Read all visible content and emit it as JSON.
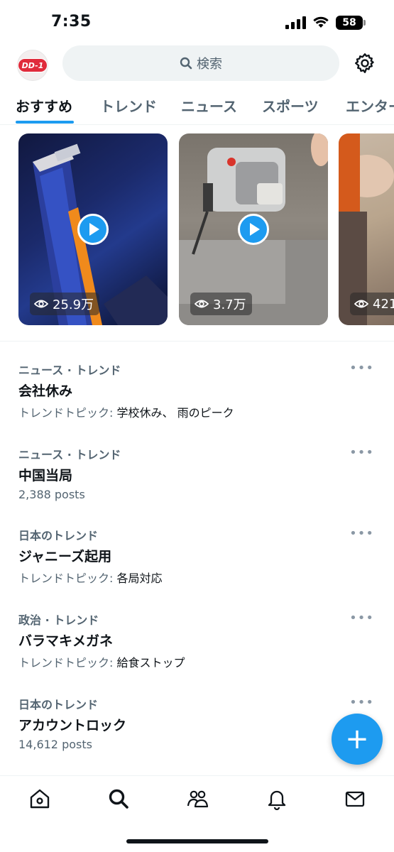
{
  "status_bar": {
    "time": "7:35",
    "battery": "58"
  },
  "header": {
    "avatar_text": "DD-1",
    "search_placeholder": "検索"
  },
  "tabs": [
    {
      "label": "おすすめ",
      "active": true
    },
    {
      "label": "トレンド",
      "active": false
    },
    {
      "label": "ニュース",
      "active": false
    },
    {
      "label": "スポーツ",
      "active": false
    },
    {
      "label": "エンター",
      "active": false
    }
  ],
  "videos": [
    {
      "views": "25.9万"
    },
    {
      "views": "3.7万"
    },
    {
      "views": "421"
    }
  ],
  "trends": [
    {
      "category": "ニュース · トレンド",
      "title": "会社休み",
      "meta_prefix": "トレンドトピック: ",
      "meta_topics": "学校休み、 雨のピーク"
    },
    {
      "category": "ニュース · トレンド",
      "title": "中国当局",
      "meta_prefix": "2,388 posts",
      "meta_topics": ""
    },
    {
      "category": "日本のトレンド",
      "title": "ジャニーズ起用",
      "meta_prefix": "トレンドトピック: ",
      "meta_topics": "各局対応"
    },
    {
      "category": "政治 · トレンド",
      "title": "バラマキメガネ",
      "meta_prefix": "トレンドトピック: ",
      "meta_topics": "給食ストップ"
    },
    {
      "category": "日本のトレンド",
      "title": "アカウントロック",
      "meta_prefix": "14,612 posts",
      "meta_topics": ""
    }
  ],
  "more_label": "•••",
  "fab_label": "+",
  "colors": {
    "accent": "#1d9bf0",
    "text": "#0f1419",
    "secondary": "#536471"
  }
}
